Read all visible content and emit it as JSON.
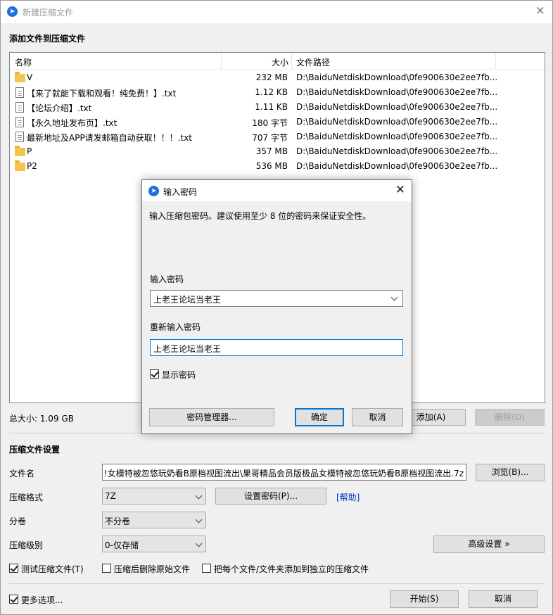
{
  "window": {
    "title": "新建压缩文件",
    "close_glyph": "✕",
    "app_icon_glyph": "➤"
  },
  "add_section": {
    "title": "添加文件到压缩文件",
    "columns": {
      "name": "名称",
      "size": "大小",
      "path": "文件路径"
    },
    "files": [
      {
        "name": "V",
        "size": "232 MB",
        "path": "D:\\BaiduNetdiskDownload\\0fe900630e2ee7fb...",
        "type": "folder"
      },
      {
        "name": "【来了就能下载和观看！纯免费！】.txt",
        "size": "1.12 KB",
        "path": "D:\\BaiduNetdiskDownload\\0fe900630e2ee7fb...",
        "type": "file"
      },
      {
        "name": "【论坛介绍】.txt",
        "size": "1.11 KB",
        "path": "D:\\BaiduNetdiskDownload\\0fe900630e2ee7fb...",
        "type": "file"
      },
      {
        "name": "【永久地址发布页】.txt",
        "size": "180 字节",
        "path": "D:\\BaiduNetdiskDownload\\0fe900630e2ee7fb...",
        "type": "file"
      },
      {
        "name": "最新地址及APP请发邮箱自动获取！！！.txt",
        "size": "707 字节",
        "path": "D:\\BaiduNetdiskDownload\\0fe900630e2ee7fb...",
        "type": "file"
      },
      {
        "name": "P",
        "size": "357 MB",
        "path": "D:\\BaiduNetdiskDownload\\0fe900630e2ee7fb...",
        "type": "folder"
      },
      {
        "name": "P2",
        "size": "536 MB",
        "path": "D:\\BaiduNetdiskDownload\\0fe900630e2ee7fb...",
        "type": "folder"
      }
    ],
    "total_size": "总大小: 1.09 GB",
    "add_button": "添加(A)",
    "delete_button": "删除(D)"
  },
  "settings": {
    "title": "压缩文件设置",
    "filename_label": "文件名",
    "filename_value": "!女模特被忽悠玩奶看B原档视图流出\\果哥精品会员版极品女模特被忽悠玩奶看B原档视图流出.7z",
    "browse_button": "浏览(B)...",
    "format_label": "压缩格式",
    "format_value": "7Z",
    "set_password_button": "设置密码(P)...",
    "help_link": "[帮助]",
    "volume_label": "分卷",
    "volume_value": "不分卷",
    "level_label": "压缩级别",
    "level_value": "0-仅存储",
    "advanced_button": "高级设置 »",
    "test_archive": "测试压缩文件(T)",
    "delete_after": "压缩后删除原始文件",
    "separate_archives": "把每个文件/文件夹添加到独立的压缩文件",
    "more_options": "更多选项...",
    "start_button": "开始(S)",
    "cancel_button": "取消"
  },
  "password_dialog": {
    "title": "输入密码",
    "description": "输入压缩包密码。建议使用至少 8 位的密码来保证安全性。",
    "password_label": "输入密码",
    "password_value": "上老王论坛当老王",
    "reenter_label": "重新输入密码",
    "reenter_value": "上老王论坛当老王",
    "show_password": "显示密码",
    "manager_button": "密码管理器...",
    "ok_button": "确定",
    "cancel_button": "取消",
    "close_glyph": "✕"
  },
  "checkboxes": {
    "test_archive": true,
    "delete_after": false,
    "separate_archives": false,
    "more_options": true,
    "show_password": true
  }
}
